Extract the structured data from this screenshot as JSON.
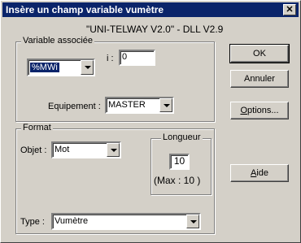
{
  "window": {
    "title": "Insère un champ variable vumètre",
    "close_label": "✕"
  },
  "header": {
    "driver": "\"UNI-TELWAY V2.0\" - DLL V2.9"
  },
  "variable_group": {
    "legend": "Variable associée",
    "variable_value": "%MWi",
    "index_label": "i :",
    "index_value": "0",
    "equipment_label": "Equipement :",
    "equipment_value": "MASTER"
  },
  "format_group": {
    "legend": "Format",
    "object_label": "Objet :",
    "object_value": "Mot",
    "length_legend": "Longueur",
    "length_value": "10",
    "max_text": "(Max : 10  )",
    "type_label": "Type :",
    "type_value": "Vumètre"
  },
  "buttons": {
    "ok": "OK",
    "cancel": "Annuler",
    "options_u": "O",
    "options_rest": "ptions...",
    "help_u": "A",
    "help_rest": "ide"
  }
}
